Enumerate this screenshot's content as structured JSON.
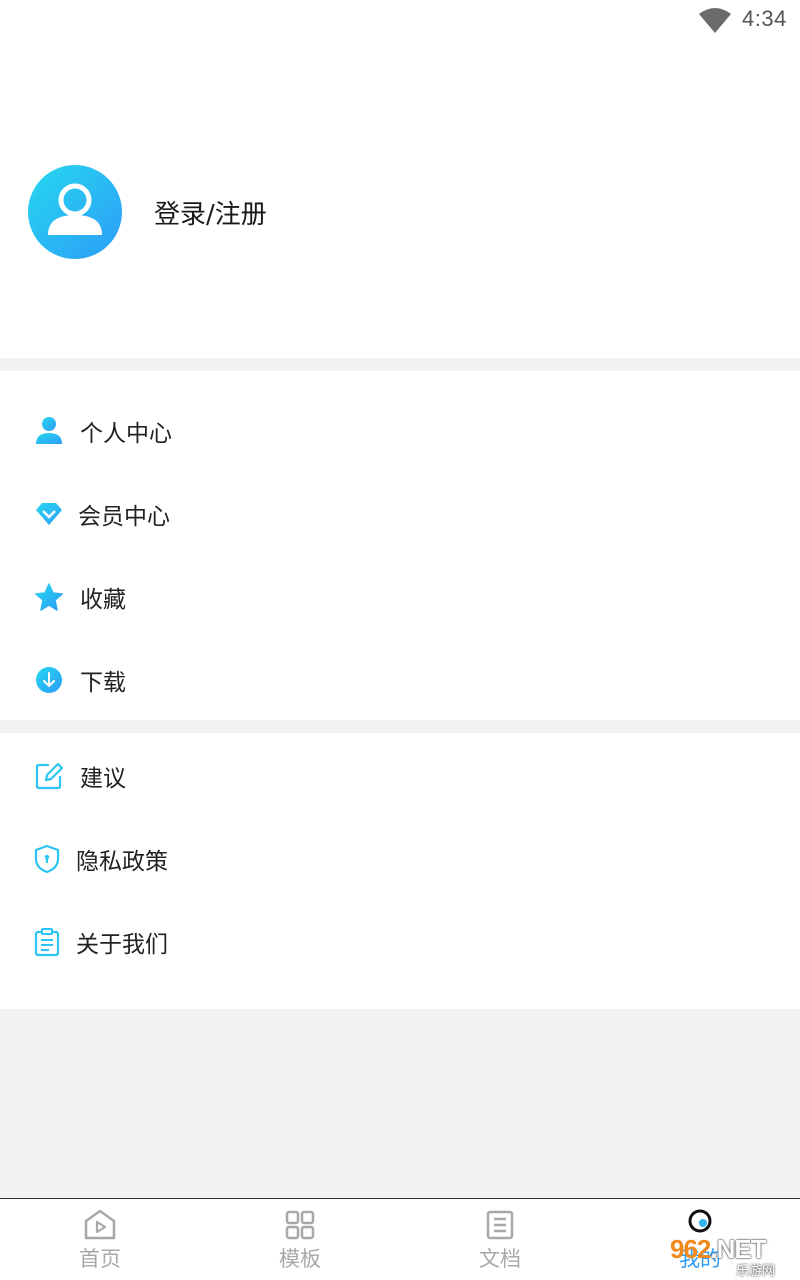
{
  "status_bar": {
    "time": "4:34",
    "wifi_icon": "wifi-icon"
  },
  "profile": {
    "login_label": "登录/注册",
    "avatar_icon": "user-avatar-icon"
  },
  "menu_section_1": [
    {
      "label": "个人中心",
      "icon": "person-icon"
    },
    {
      "label": "会员中心",
      "icon": "diamond-icon"
    },
    {
      "label": "收藏",
      "icon": "star-icon"
    },
    {
      "label": "下载",
      "icon": "download-icon"
    }
  ],
  "menu_section_2": [
    {
      "label": "建议",
      "icon": "edit-icon"
    },
    {
      "label": "隐私政策",
      "icon": "shield-icon"
    },
    {
      "label": "关于我们",
      "icon": "clipboard-icon"
    }
  ],
  "bottom_nav": [
    {
      "label": "首页",
      "icon": "home-play-icon"
    },
    {
      "label": "模板",
      "icon": "grid-icon"
    },
    {
      "label": "文档",
      "icon": "document-icon"
    },
    {
      "label": "我的",
      "icon": "user-icon"
    }
  ],
  "watermark": {
    "number": "962",
    "suffix": ".NET",
    "sub": "乐游网"
  },
  "colors": {
    "accent_start": "#27d8ef",
    "accent_end": "#2c9cf7",
    "nav_inactive": "#a8a8a8"
  }
}
